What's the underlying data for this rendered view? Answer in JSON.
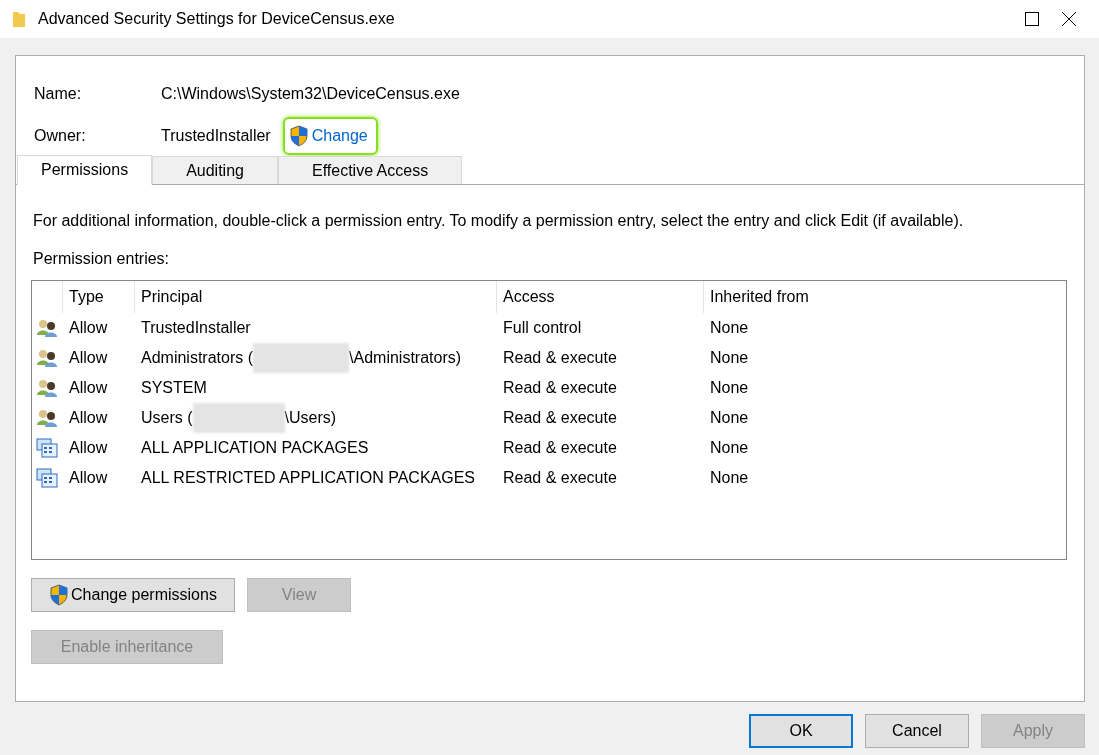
{
  "window": {
    "title": "Advanced Security Settings for DeviceCensus.exe"
  },
  "name": {
    "label": "Name:",
    "value": "C:\\Windows\\System32\\DeviceCensus.exe"
  },
  "owner": {
    "label": "Owner:",
    "value": "TrustedInstaller",
    "change_link": {
      "label": "Change",
      "highlighted": true
    }
  },
  "tabs": [
    {
      "label": "Permissions",
      "selected": true
    },
    {
      "label": "Auditing",
      "selected": false
    },
    {
      "label": "Effective Access",
      "selected": false
    }
  ],
  "info_text": "For additional information, double-click a permission entry. To modify a permission entry, select the entry and click Edit (if available).",
  "entries_label": "Permission entries:",
  "table": {
    "columns": [
      "Type",
      "Principal",
      "Access",
      "Inherited from"
    ],
    "rows": [
      {
        "kind": "group",
        "type": "Allow",
        "principal": "TrustedInstaller",
        "access": "Full control",
        "inherited_from": "None"
      },
      {
        "kind": "group",
        "type": "Allow",
        "principal": "Administrators (",
        "redacted": true,
        "principal_end": "\\Administrators)",
        "access": "Read & execute",
        "inherited_from": "None"
      },
      {
        "kind": "group",
        "type": "Allow",
        "principal": "SYSTEM",
        "access": "Read & execute",
        "inherited_from": "None"
      },
      {
        "kind": "group",
        "type": "Allow",
        "principal": "Users (",
        "redacted": true,
        "principal_end": "\\Users)",
        "access": "Read & execute",
        "inherited_from": "None"
      },
      {
        "kind": "package",
        "type": "Allow",
        "principal": "ALL APPLICATION PACKAGES",
        "access": "Read & execute",
        "inherited_from": "None"
      },
      {
        "kind": "package",
        "type": "Allow",
        "principal": "ALL RESTRICTED APPLICATION PACKAGES",
        "access": "Read & execute",
        "inherited_from": "None"
      }
    ]
  },
  "actions": [
    {
      "label": "Change permissions",
      "shield": true,
      "disabled": false
    },
    {
      "label": "View",
      "shield": false,
      "disabled": true
    }
  ],
  "inheritance_button": {
    "label": "Enable inheritance",
    "disabled": true
  },
  "buttons": [
    {
      "label": "OK",
      "default": true,
      "disabled": false
    },
    {
      "label": "Cancel",
      "default": false,
      "disabled": false
    },
    {
      "label": "Apply",
      "default": false,
      "disabled": true
    }
  ]
}
